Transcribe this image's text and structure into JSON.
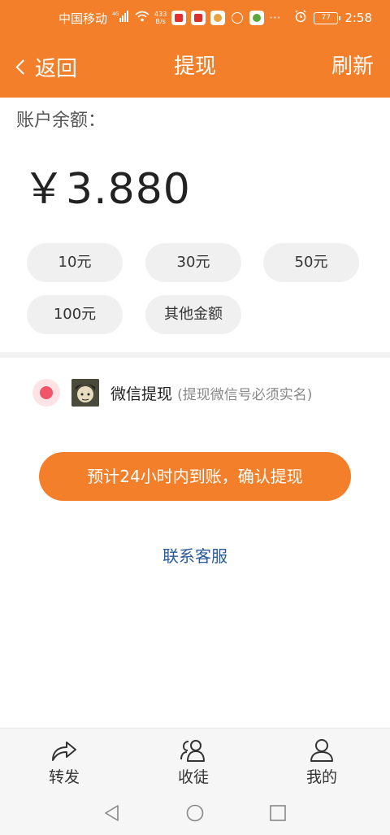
{
  "status_bar": {
    "carrier": "中国移动",
    "network_type": "4G",
    "speed_value": "433",
    "speed_unit": "B/s",
    "battery": "77",
    "time": "2:58",
    "more": "···"
  },
  "header": {
    "back_label": "返回",
    "title": "提现",
    "refresh_label": "刷新"
  },
  "balance": {
    "label": "账户余额：",
    "amount": "￥3.880"
  },
  "amount_options": [
    "10元",
    "30元",
    "50元",
    "100元",
    "其他金额"
  ],
  "withdraw_method": {
    "label": "微信提现",
    "note": "(提现微信号必须实名)"
  },
  "confirm_button": "预计24小时内到账，确认提现",
  "contact_link": "联系客服",
  "tabs": [
    {
      "label": "转发",
      "icon": "share-icon"
    },
    {
      "label": "收徒",
      "icon": "users-icon"
    },
    {
      "label": "我的",
      "icon": "user-icon"
    }
  ],
  "colors": {
    "brand": "#f47f2a",
    "radio_active": "#f0556a",
    "link": "#2a5a9a"
  }
}
